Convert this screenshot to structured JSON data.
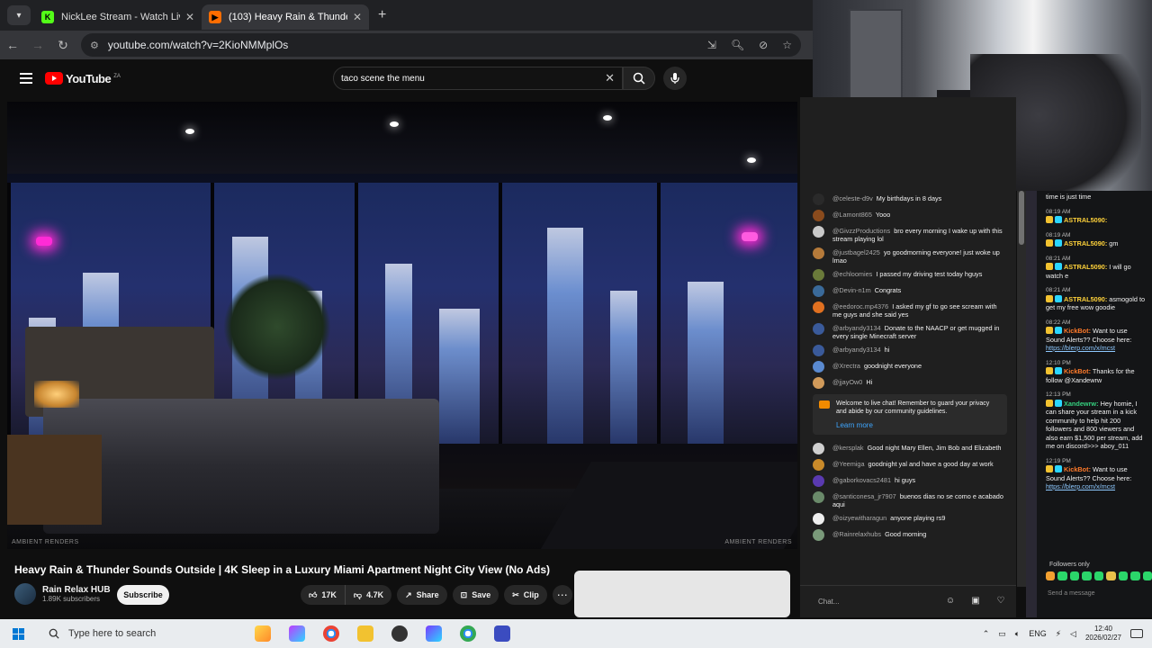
{
  "browser": {
    "tabs": [
      {
        "title": "NickLee Stream - Watch Live on",
        "active": false
      },
      {
        "title": "(103) Heavy Rain & Thunde",
        "active": true
      }
    ],
    "url": "youtube.com/watch?v=2KioNMMplOs"
  },
  "youtube": {
    "logo": "YouTube",
    "country": "ZA",
    "search_value": "taco scene the menu"
  },
  "video": {
    "watermark_left": "AMBIENT RENDERS",
    "watermark_right": "AMBIENT RENDERS",
    "title": "Heavy Rain & Thunder Sounds Outside | 4K Sleep in a Luxury Miami Apartment Night City View (No Ads)",
    "channel": "Rain Relax HUB",
    "subscribers": "1.89K subscribers",
    "subscribe_label": "Subscribe",
    "likes": "17K",
    "dislikes": "4.7K",
    "share_label": "Share",
    "save_label": "Save",
    "clip_label": "Clip"
  },
  "live_chat": {
    "messages": [
      {
        "user": "@celeste-d9v",
        "text": "My birthdays in 8 days",
        "color": "#2a2a2a"
      },
      {
        "user": "@Lamont865",
        "text": "Yooo",
        "color": "#8a4b1d"
      },
      {
        "user": "@GivzzProductions",
        "text": "bro every morning I wake up with this stream playing lol",
        "color": "#c9c9c9"
      },
      {
        "user": "@justbagel2425",
        "text": "yo goodmorning everyone! just woke up lmao",
        "color": "#b57a3a"
      },
      {
        "user": "@echloomies",
        "text": "I passed my driving test today hguys",
        "color": "#6a7a3a"
      },
      {
        "user": "@Devin-n1m",
        "text": "Congrats",
        "color": "#3a6a9a"
      },
      {
        "user": "@eedoroc.mp4376",
        "text": "I asked my gf to go see scream with me guys and she said yes",
        "color": "#e07020"
      },
      {
        "user": "@arbyandy3134",
        "text": "Donate to the NAACP or get mugged in every single Minecraft server",
        "color": "#3a5a9a"
      },
      {
        "user": "@arbyandy3134",
        "text": "hi",
        "color": "#3a5a9a"
      },
      {
        "user": "@Xrectra",
        "text": "goodnight everyone",
        "color": "#5a8ad0"
      },
      {
        "user": "@jjayOw0",
        "text": "Hi",
        "color": "#d09a5a"
      }
    ],
    "notice": {
      "text": "Welcome to live chat! Remember to guard your privacy and abide by our community guidelines.",
      "link": "Learn more"
    },
    "messages_after": [
      {
        "user": "@kersplak",
        "text": "Good night Mary Ellen, Jim Bob and Elizabeth",
        "color": "#cfcfcf"
      },
      {
        "user": "@Yeemiga",
        "text": "goodnight yal and have a good day at work",
        "color": "#c98a2a"
      },
      {
        "user": "@gaborkovacs2481",
        "text": "hi guys",
        "color": "#5a3ab0"
      },
      {
        "user": "@santiconesa_jr7907",
        "text": "buenos dias no se como e acabado aqui",
        "color": "#6a8a6a"
      },
      {
        "user": "@oizyewitharagun",
        "text": "anyone playing rs9",
        "color": "#eeeeee"
      },
      {
        "user": "@Rainrelaxhubs",
        "text": "Good morning",
        "color": "#7a9a7a"
      }
    ],
    "input_placeholder": "Chat..."
  },
  "kick_chat": {
    "top_text": "time is just time",
    "messages": [
      {
        "time": "08:19 AM",
        "user": "ASTRAL5090:",
        "text": ""
      },
      {
        "time": "08:19 AM",
        "user": "ASTRAL5090:",
        "text": "gm"
      },
      {
        "time": "08:21 AM",
        "user": "ASTRAL5090:",
        "text": "I will go watch e"
      },
      {
        "time": "08:21 AM",
        "user": "ASTRAL5090:",
        "text": "asmogold to get my free wow goodie"
      },
      {
        "time": "08:22 AM",
        "user": "KickBot:",
        "text": "Want to use Sound Alerts?? Choose here:",
        "link": "https://blerp.com/x/mcst"
      },
      {
        "time": "12:10 PM",
        "user": "KickBot:",
        "text": "Thanks for the follow @Xandewrw"
      },
      {
        "time": "12:13 PM",
        "user": "Xandewrw:",
        "text": "Hey homie, I can share your stream in a kick community to help hit 200 followers and 800 viewers and also earn $1,500 per stream, add me on discord>>> aboy_011"
      },
      {
        "time": "12:19 PM",
        "user": "KickBot:",
        "text": "Want to use Sound Alerts?? Choose here:",
        "link": "https://blerp.com/x/mcst"
      }
    ],
    "followers_label": "Followers only",
    "send_placeholder": "Send a message"
  },
  "taskbar": {
    "search_placeholder": "Type here to search",
    "language": "ENG",
    "time": "12:40",
    "date": "2026/02/27"
  }
}
